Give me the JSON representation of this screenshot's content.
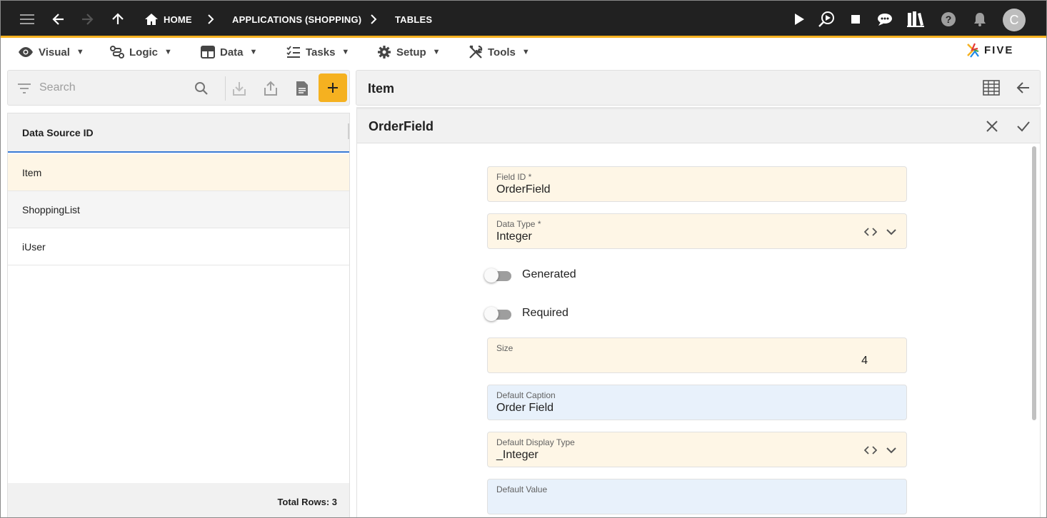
{
  "appbar": {
    "breadcrumbs": [
      {
        "label": "HOME"
      },
      {
        "label": "APPLICATIONS (SHOPPING)"
      },
      {
        "label": "TABLES"
      }
    ],
    "avatar_initial": "C",
    "icons": [
      "menu-icon",
      "back-arrow-icon",
      "forward-arrow-icon",
      "up-arrow-icon",
      "home-icon",
      "play-icon",
      "run-debug-icon",
      "stop-icon",
      "chat-icon",
      "library-icon",
      "help-icon",
      "notifications-icon"
    ]
  },
  "menubar": {
    "items": [
      {
        "label": "Visual",
        "icon": "eye-icon"
      },
      {
        "label": "Logic",
        "icon": "logic-icon"
      },
      {
        "label": "Data",
        "icon": "table-icon"
      },
      {
        "label": "Tasks",
        "icon": "checklist-icon"
      },
      {
        "label": "Setup",
        "icon": "gear-icon"
      },
      {
        "label": "Tools",
        "icon": "tools-icon"
      }
    ],
    "caret": "▼",
    "logo_text": "FIVE"
  },
  "left": {
    "search_placeholder": "Search",
    "column_header": "Data Source ID",
    "rows": [
      "Item",
      "ShoppingList",
      "iUser"
    ],
    "selected_index": 0,
    "footer": "Total Rows: 3"
  },
  "right": {
    "title": "Item",
    "form": {
      "title": "OrderField",
      "fields": {
        "field_id": {
          "label": "Field ID *",
          "value": "OrderField"
        },
        "data_type": {
          "label": "Data Type *",
          "value": "Integer"
        },
        "generated": {
          "label": "Generated",
          "checked": false
        },
        "required": {
          "label": "Required",
          "checked": false
        },
        "size": {
          "label": "Size",
          "value": "4"
        },
        "default_caption": {
          "label": "Default Caption",
          "value": "Order Field"
        },
        "default_display_type": {
          "label": "Default Display Type",
          "value": "_Integer"
        },
        "default_value": {
          "label": "Default Value",
          "value": ""
        }
      }
    }
  },
  "colors": {
    "appbar_bg": "#212121",
    "accent": "#f5b120",
    "selected_row": "#fef6e6",
    "field_yellow": "#fef6e6",
    "field_blue": "#e8f1fb",
    "header_underline": "#3a7bd5"
  }
}
